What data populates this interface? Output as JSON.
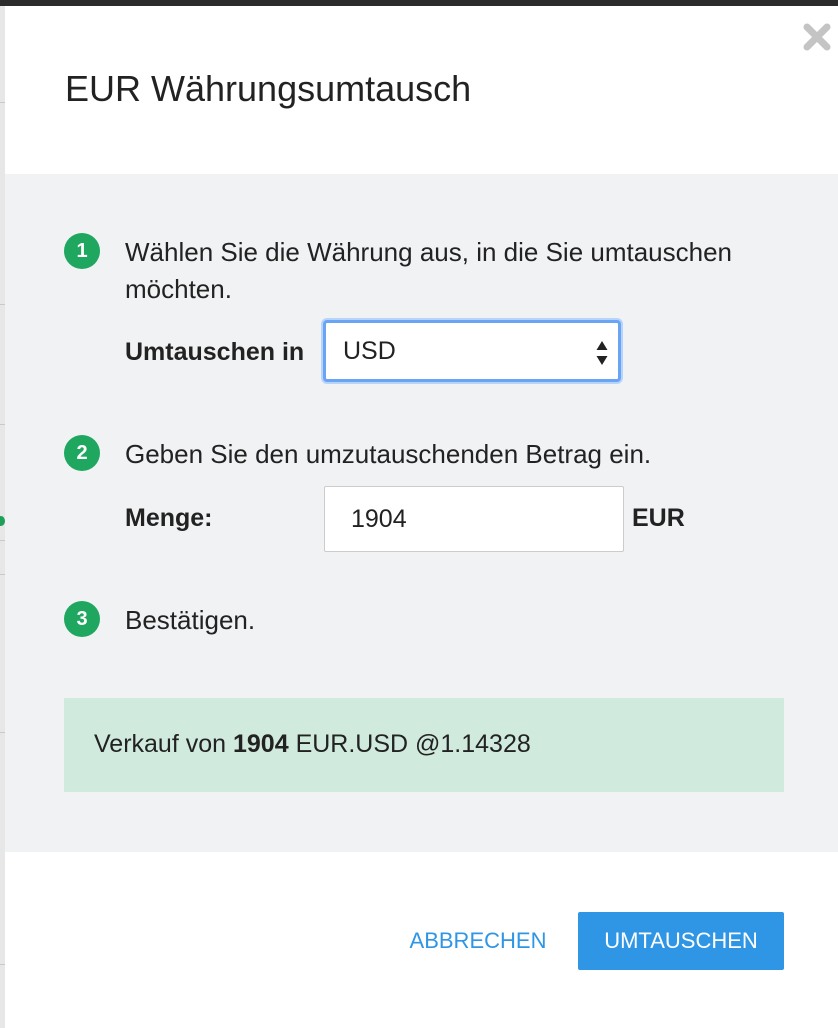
{
  "dialog": {
    "title": "EUR Währungsumtausch",
    "close_icon": "close-icon"
  },
  "steps": [
    {
      "number": "1",
      "text": "Wählen Sie die Währung aus, in die Sie umtauschen möchten."
    },
    {
      "number": "2",
      "text": "Geben Sie den umzutauschenden Betrag ein."
    },
    {
      "number": "3",
      "text": "Bestätigen."
    }
  ],
  "exchange_to": {
    "label": "Umtauschen in",
    "selected": "USD",
    "arrows_icon": "select-arrows-icon"
  },
  "amount": {
    "label": "Menge:",
    "value": "1904",
    "unit": "EUR"
  },
  "summary": {
    "prefix": "Verkauf von",
    "amount": "1904",
    "pair": "EUR.USD @1.14328"
  },
  "buttons": {
    "cancel": "ABBRECHEN",
    "exchange": "UMTAUSCHEN"
  },
  "colors": {
    "step_badge": "#1fa760",
    "primary": "#2f96e6",
    "summary_bg": "#d0ebdd",
    "panel_bg": "#f1f2f4",
    "select_focus": "#6aa5f5"
  }
}
